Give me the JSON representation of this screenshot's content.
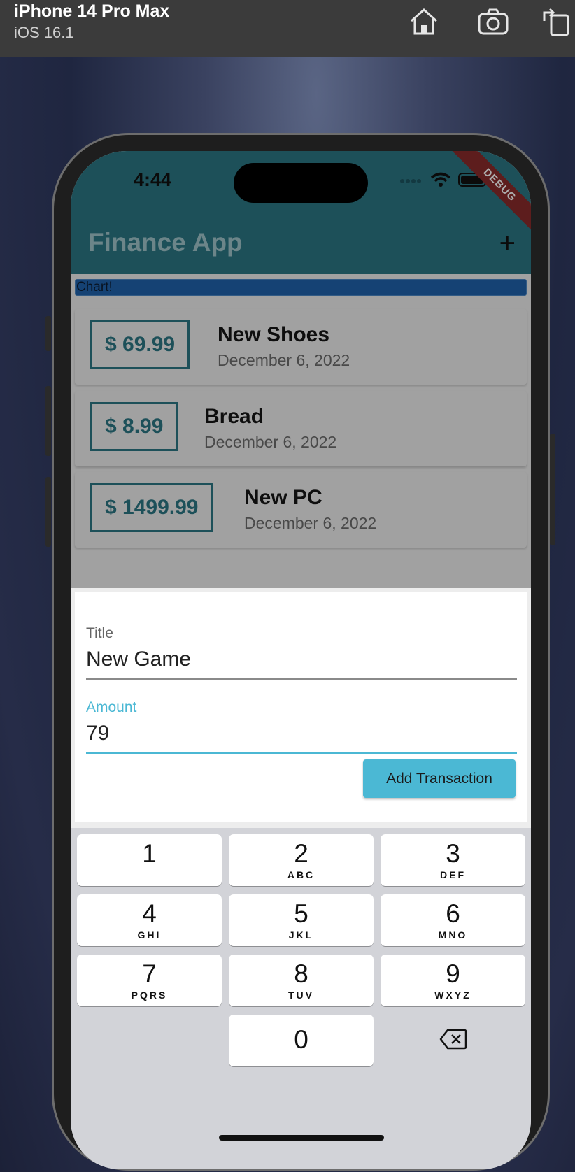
{
  "simulator": {
    "device_name": "iPhone 14 Pro Max",
    "os_version": "iOS 16.1",
    "buttons": [
      "home-icon",
      "screenshot-icon",
      "rotate-icon"
    ]
  },
  "status_bar": {
    "time": "4:44",
    "debug_banner": "DEBUG"
  },
  "app_bar": {
    "title": "Finance App",
    "add_icon": "+"
  },
  "chart": {
    "label": "Chart!"
  },
  "transactions": [
    {
      "amount": "$ 69.99",
      "title": "New Shoes",
      "date": "December 6, 2022"
    },
    {
      "amount": "$ 8.99",
      "title": "Bread",
      "date": "December 6, 2022"
    },
    {
      "amount": "$ 1499.99",
      "title": "New PC",
      "date": "December 6, 2022"
    }
  ],
  "form": {
    "title_label": "Title",
    "title_value": "New Game",
    "amount_label": "Amount",
    "amount_value": "79",
    "submit_label": "Add Transaction"
  },
  "keyboard": {
    "keys": [
      {
        "num": "1",
        "letters": ""
      },
      {
        "num": "2",
        "letters": "ABC"
      },
      {
        "num": "3",
        "letters": "DEF"
      },
      {
        "num": "4",
        "letters": "GHI"
      },
      {
        "num": "5",
        "letters": "JKL"
      },
      {
        "num": "6",
        "letters": "MNO"
      },
      {
        "num": "7",
        "letters": "PQRS"
      },
      {
        "num": "8",
        "letters": "TUV"
      },
      {
        "num": "9",
        "letters": "WXYZ"
      },
      {
        "num": "0",
        "letters": ""
      }
    ]
  },
  "colors": {
    "primary": "#2c7784",
    "accent": "#4bb8d4",
    "chart_bar": "#2062ac",
    "debug": "#8a2b2b"
  }
}
